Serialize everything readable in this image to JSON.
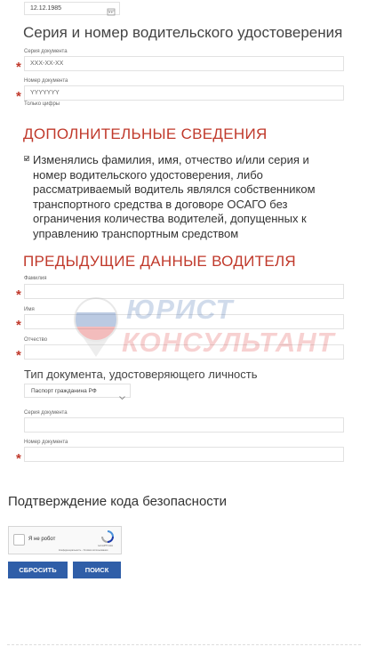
{
  "date_field": {
    "value": "12.12.1985",
    "icon": "calendar-icon"
  },
  "license_section": {
    "title": "Серия и номер водительского удостоверения",
    "series_label": "Серия документа",
    "series_placeholder": "XXX-XX-XX",
    "number_label": "Номер документа",
    "number_placeholder": "YYYYYYY",
    "number_hint": "Только цифры"
  },
  "additional_section": {
    "title": "ДОПОЛНИТЕЛЬНЫЕ СВЕДЕНИЯ",
    "checkbox_checked": true,
    "checkbox_text": "Изменялись фамилия, имя, отчество и/или серия и номер водительского удостоверения, либо рассматриваемый водитель являлся собственником транспортного средства в договоре ОСАГО без ограничения количества водителей, допущенных к управлению транспортным средством"
  },
  "previous_section": {
    "title": "ПРЕДЫДУЩИЕ ДАННЫЕ ВОДИТЕЛЯ",
    "surname_label": "Фамилия",
    "name_label": "Имя",
    "patronymic_label": "Отчество",
    "doc_type_title": "Тип документа, удостоверяющего личность",
    "doc_type_selected": "Паспорт гражданина РФ",
    "doc_series_label": "Серия документа",
    "doc_number_label": "Номер документа"
  },
  "watermark": {
    "line1": "ЮРИСТ",
    "line2": "КОНСУЛЬТАНТ"
  },
  "security": {
    "title": "Подтверждение кода безопасности",
    "captcha_label": "Я не робот",
    "captcha_brand": "reCAPTCHA",
    "captcha_links": "Конфиденциальность - Условия использования"
  },
  "buttons": {
    "reset": "СБРОСИТЬ",
    "search": "ПОИСК"
  },
  "colors": {
    "accent_red": "#c0392b",
    "button_blue": "#2f5ea8",
    "star_red": "#c0392b"
  }
}
